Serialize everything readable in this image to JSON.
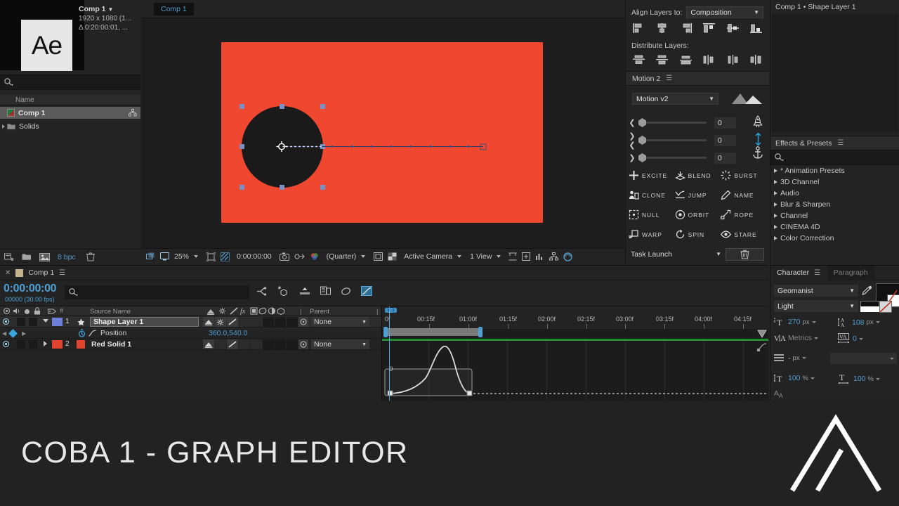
{
  "project": {
    "title": "Comp 1",
    "resolution": "1920 x 1080 (1...",
    "duration": "Δ 0:20:00:01, ...",
    "logo_text": "Ae",
    "search_placeholder": "",
    "column_header": "Name",
    "items": [
      {
        "name": "Comp 1",
        "type": "composition",
        "selected": true
      },
      {
        "name": "Solids",
        "type": "folder",
        "selected": false
      }
    ],
    "footer": {
      "bit_depth": "8 bpc"
    }
  },
  "comp_viewer": {
    "tab_label": "Comp 1",
    "footer": {
      "zoom": "25%",
      "timecode": "0:00:00:00",
      "resolution": "(Quarter)",
      "camera": "Active Camera",
      "views": "1 View"
    },
    "stage": {
      "solid_color": "#f04830",
      "circle_color": "#1a1a1a",
      "handle_color": "#7a8fc4"
    }
  },
  "align_panel": {
    "align_label": "Align Layers to:",
    "align_target": "Composition",
    "distribute_label": "Distribute Layers:"
  },
  "motion_panel": {
    "title": "Motion 2",
    "version": "Motion v2",
    "sliders": [
      {
        "icon": "chevron-left",
        "value": "0"
      },
      {
        "icon": "chevrons-inward",
        "value": "0"
      },
      {
        "icon": "chevron-right",
        "value": "0"
      }
    ],
    "side_icons": [
      "rocket-icon",
      "arrows-vertical-icon",
      "anchor-icon"
    ],
    "buttons": [
      {
        "label": "EXCITE",
        "icon": "plus-icon"
      },
      {
        "label": "BLEND",
        "icon": "blend-icon"
      },
      {
        "label": "BURST",
        "icon": "burst-icon"
      },
      {
        "label": "CLONE",
        "icon": "clone-icon"
      },
      {
        "label": "JUMP",
        "icon": "jump-icon"
      },
      {
        "label": "NAME",
        "icon": "pencil-icon"
      },
      {
        "label": "NULL",
        "icon": "null-icon"
      },
      {
        "label": "ORBIT",
        "icon": "orbit-icon"
      },
      {
        "label": "ROPE",
        "icon": "rope-icon"
      },
      {
        "label": "WARP",
        "icon": "warp-icon"
      },
      {
        "label": "SPIN",
        "icon": "spin-icon"
      },
      {
        "label": "STARE",
        "icon": "eye-icon"
      }
    ]
  },
  "task_launch": {
    "label": "Task Launch"
  },
  "layer_panel": {
    "title": "Comp 1 • Shape Layer 1"
  },
  "effects_panel": {
    "title": "Effects & Presets",
    "search_placeholder": "",
    "categories": [
      "* Animation Presets",
      "3D Channel",
      "Audio",
      "Blur & Sharpen",
      "Channel",
      "CINEMA 4D",
      "Color Correction"
    ]
  },
  "timeline": {
    "tab_label": "Comp 1",
    "current_time": "0:00:00:00",
    "frame_info": "00000 (30.00 fps)",
    "search_placeholder": "",
    "columns": {
      "source_name": "Source Name",
      "parent": "Parent"
    },
    "layers": [
      {
        "index": "1",
        "name": "Shape Layer 1",
        "color": "#6d7fd6",
        "parent": "None",
        "selected": true,
        "property": {
          "name": "Position",
          "value": "360.0,540.0"
        }
      },
      {
        "index": "2",
        "name": "Red Solid 1",
        "color": "#e0442e",
        "parent": "None",
        "selected": false
      }
    ],
    "ruler_ticks": [
      "0f",
      "00:15f",
      "01:00f",
      "01:15f",
      "02:00f",
      "02:15f",
      "03:00f",
      "03:15f",
      "04:00f",
      "04:15f"
    ],
    "graph": {
      "value_label": "0"
    }
  },
  "character_panel": {
    "tab_active": "Character",
    "tab_inactive": "Paragraph",
    "font_family": "Geomanist",
    "font_style": "Light",
    "font_size": "270",
    "font_size_unit": "px",
    "leading": "108",
    "leading_unit": "px",
    "kerning": "Metrics",
    "tracking": "0",
    "stroke_width": "-",
    "stroke_width_unit": "px",
    "vertical_scale": "100",
    "vertical_scale_unit": "%",
    "horizontal_scale": "100",
    "horizontal_scale_unit": "%"
  },
  "bottom_bar": {
    "title": "COBA 1 - GRAPH EDITOR",
    "logo": "double-chevron-logo"
  },
  "colors": {
    "accent_blue": "#4d9fd4",
    "solid_red": "#f04830",
    "panel_bg": "#232323",
    "green_bar": "#1f8c2f"
  }
}
